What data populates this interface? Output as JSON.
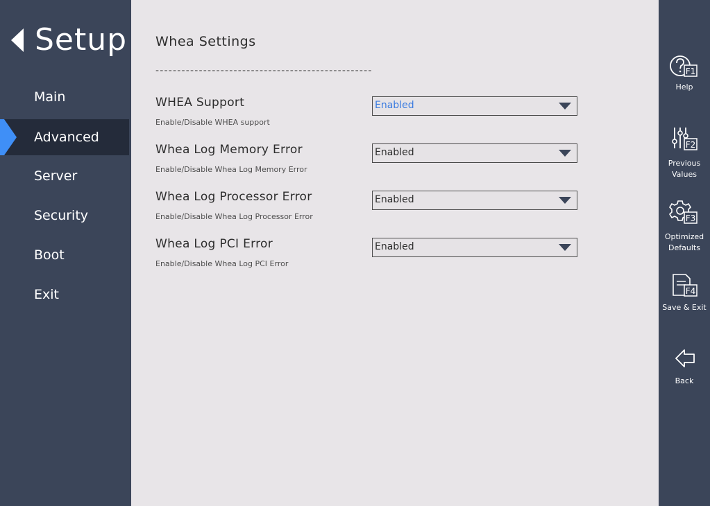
{
  "sidebar": {
    "title": "Setup",
    "items": [
      {
        "label": "Main"
      },
      {
        "label": "Advanced"
      },
      {
        "label": "Server"
      },
      {
        "label": "Security"
      },
      {
        "label": "Boot"
      },
      {
        "label": "Exit"
      }
    ],
    "active_item": "Advanced"
  },
  "main": {
    "title": "Whea Settings",
    "divider": "--------------------------------------------------",
    "settings": [
      {
        "label": "WHEA Support",
        "help": "Enable/Disable WHEA support",
        "value": "Enabled"
      },
      {
        "label": "Whea Log Memory Error",
        "help": "Enable/Disable Whea Log Memory Error",
        "value": "Enabled"
      },
      {
        "label": "Whea Log Processor Error",
        "help": "Enable/Disable Whea Log Processor Error",
        "value": "Enabled"
      },
      {
        "label": "Whea Log PCI Error",
        "help": "Enable/Disable Whea Log PCI Error",
        "value": "Enabled"
      }
    ]
  },
  "toolbar": {
    "help": {
      "label": "Help",
      "key": "F1"
    },
    "previous": {
      "label_line1": "Previous",
      "label_line2": "Values",
      "key": "F2"
    },
    "optimized": {
      "label_line1": "Optimized",
      "label_line2": "Defaults",
      "key": "F3"
    },
    "save_exit": {
      "label": "Save & Exit",
      "key": "F4"
    },
    "back": {
      "label": "Back"
    }
  },
  "colors": {
    "sidebar_bg": "#3b4559",
    "active_nav_bg": "#242b3a",
    "accent": "#3f8ff7",
    "focused_value": "#3a7be0",
    "content_bg": "#e8e5e8"
  }
}
